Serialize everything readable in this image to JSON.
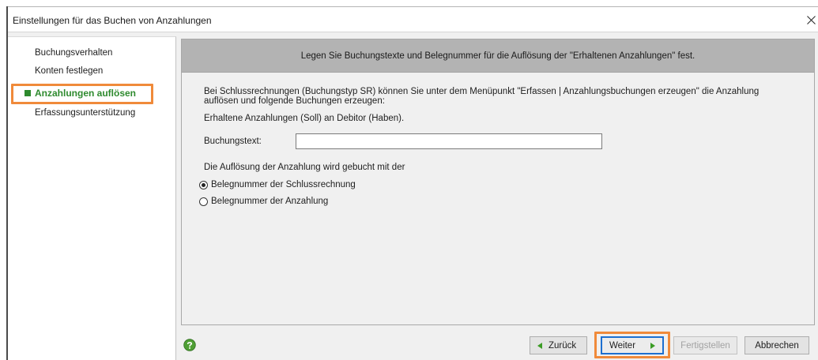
{
  "window": {
    "title": "Einstellungen für das Buchen von Anzahlungen"
  },
  "sidebar": {
    "items": [
      {
        "label": "Buchungsverhalten",
        "active": false
      },
      {
        "label": "Konten festlegen",
        "active": false
      },
      {
        "label": "Anzahlungen auflösen",
        "active": true
      },
      {
        "label": "Erfassungsunterstützung",
        "active": false
      }
    ]
  },
  "main": {
    "header": "Legen Sie Buchungstexte und Belegnummer für die Auflösung der \"Erhaltenen Anzahlungen\" fest.",
    "intro": [
      "Bei Schlussrechnungen (Buchungstyp SR) können Sie unter dem Menüpunkt \"Erfassen | Anzahlungsbuchungen erzeugen\" die Anzahlung",
      "auflösen und folgende Buchungen erzeugen:"
    ],
    "posting": "Erhaltene Anzahlungen (Soll) an Debitor (Haben).",
    "buchungstext": {
      "label": "Buchungstext:",
      "value": ""
    },
    "numbering": {
      "label": "Die Auflösung der Anzahlung wird gebucht mit der",
      "options": [
        {
          "label": "Belegnummer der Schlussrechnung",
          "checked": true
        },
        {
          "label": "Belegnummer der Anzahlung",
          "checked": false
        }
      ]
    }
  },
  "footer": {
    "back": {
      "label": "Zurück",
      "enabled": true
    },
    "next": {
      "label": "Weiter",
      "enabled": true
    },
    "finish": {
      "label": "Fertigstellen",
      "enabled": false
    },
    "cancel": {
      "label": "Abbrechen",
      "enabled": true
    }
  },
  "icons": {
    "close": "close-icon",
    "active_step": "square-bullet-icon",
    "help": "help-icon",
    "back": "triangle-left-icon",
    "next": "triangle-right-icon"
  },
  "colors": {
    "active_step": "#2e8a2e",
    "highlight": "#f08a3a",
    "focus": "#1d6fd0",
    "header_band": "#b3b3b3",
    "help_icon": "#4f9f34",
    "nav_arrow": "#3b9c24"
  }
}
